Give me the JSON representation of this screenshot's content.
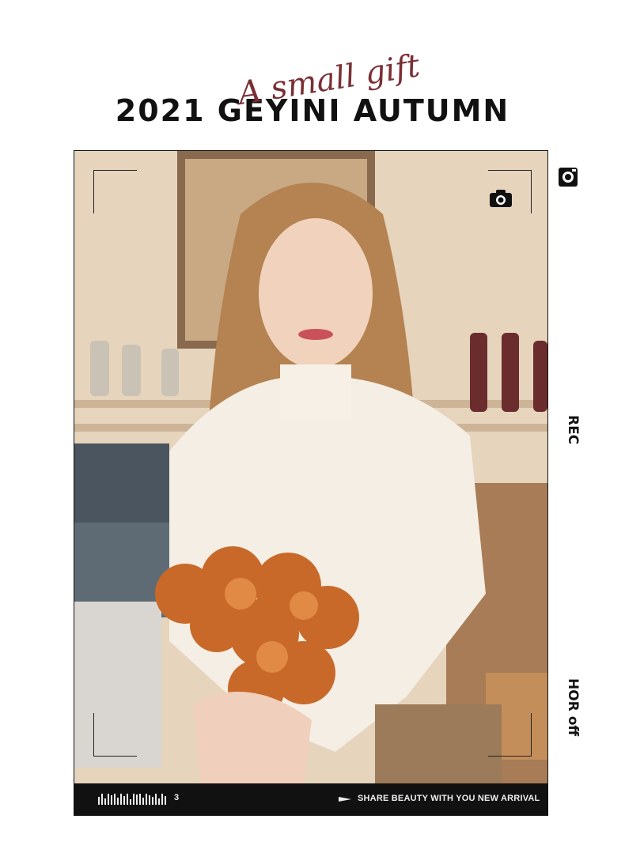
{
  "header": {
    "title": "2021 GEYINI AUTUMN",
    "script_overlay": "A small gift"
  },
  "photo": {
    "description_icon": "camera-icon"
  },
  "bottom_bar": {
    "barcode_number": "3",
    "tagline": "SHARE BEAUTY WITH YOU NEW ARRIVAL"
  },
  "side_labels": {
    "rec": "REC",
    "hor": "HOR off"
  },
  "colors": {
    "title": "#111111",
    "script": "#7a2f35",
    "bar": "#111111"
  }
}
